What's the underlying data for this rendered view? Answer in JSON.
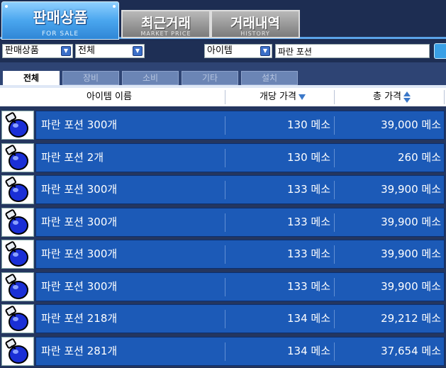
{
  "top_tabs": [
    {
      "label": "판매상품",
      "sub": "FOR SALE",
      "active": true
    },
    {
      "label": "최근거래",
      "sub": "MARKET PRICE",
      "active": false
    },
    {
      "label": "거래내역",
      "sub": "HISTORY",
      "active": false
    }
  ],
  "filters": {
    "type_select": "판매상품",
    "category_select": "전체",
    "search_field_select": "아이템",
    "search_value": "파란 포션"
  },
  "subtabs": [
    {
      "label": "전체",
      "active": true
    },
    {
      "label": "장비",
      "active": false
    },
    {
      "label": "소비",
      "active": false
    },
    {
      "label": "기타",
      "active": false
    },
    {
      "label": "설치",
      "active": false
    }
  ],
  "columns": {
    "name": "아이템 이름",
    "unit_price": "개당 가격",
    "total_price": "총 가격"
  },
  "rows": [
    {
      "name": "파란 포션 300개",
      "unit": "130 메소",
      "total": "39,000 메소"
    },
    {
      "name": "파란 포션 2개",
      "unit": "130 메소",
      "total": "260 메소"
    },
    {
      "name": "파란 포션 300개",
      "unit": "133 메소",
      "total": "39,900 메소"
    },
    {
      "name": "파란 포션 300개",
      "unit": "133 메소",
      "total": "39,900 메소"
    },
    {
      "name": "파란 포션 300개",
      "unit": "133 메소",
      "total": "39,900 메소"
    },
    {
      "name": "파란 포션 300개",
      "unit": "133 메소",
      "total": "39,900 메소"
    },
    {
      "name": "파란 포션 218개",
      "unit": "134 메소",
      "total": "29,212 메소"
    },
    {
      "name": "파란 포션 281개",
      "unit": "134 메소",
      "total": "37,654 메소"
    }
  ],
  "colors": {
    "accent": "#2f86d6",
    "row_bar": "#1c5ab7",
    "background": "#1e2f55"
  },
  "icons": {
    "row_item": "blue-potion-icon"
  }
}
